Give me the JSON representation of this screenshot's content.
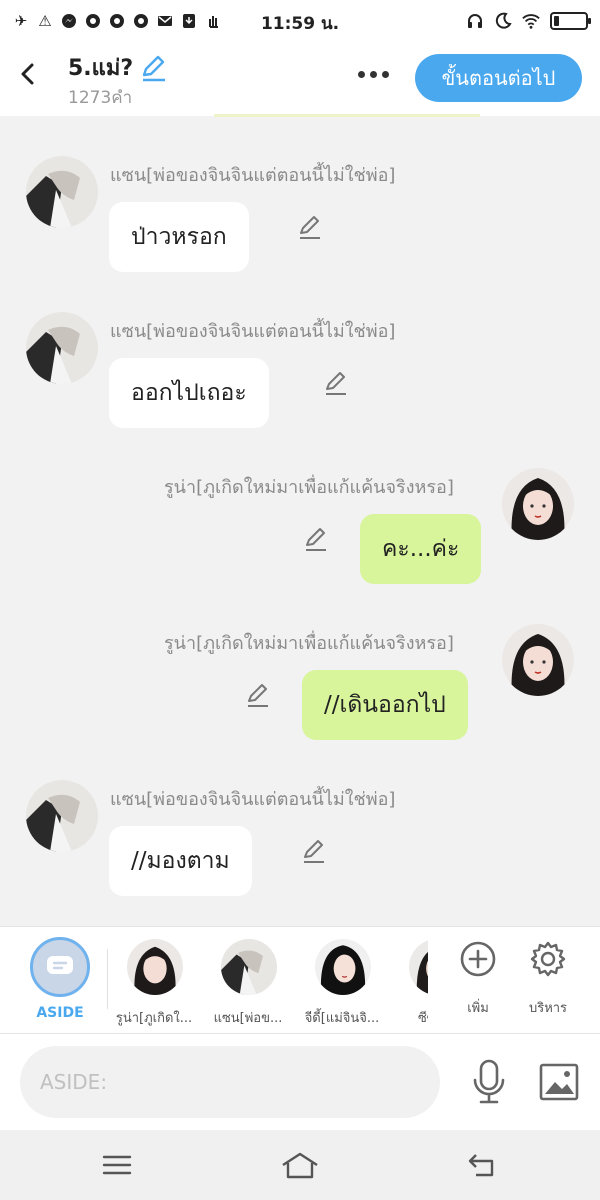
{
  "status_bar": {
    "time": "11:59 น.",
    "left_icons": [
      "airplane-icon",
      "warning-icon",
      "messenger-icon",
      "chrome-icon",
      "chrome-icon",
      "chrome-icon",
      "mail-icon",
      "download-icon",
      "hand-icon"
    ],
    "right_icons": [
      "headphones-icon",
      "moon-icon",
      "wifi-icon",
      "battery-icon"
    ],
    "battery_level": 0.15
  },
  "header": {
    "title": "5.แม่?",
    "word_count": "1273คำ",
    "next_label": "ขั้นตอนต่อไป"
  },
  "messages": [
    {
      "side": "left",
      "speaker": "แซน[พ่อของจินจินแต่ตอนนี้ไม่ใช่พ่อ]",
      "text": "ป่าวหรอก"
    },
    {
      "side": "left",
      "speaker": "แซน[พ่อของจินจินแต่ตอนนี้ไม่ใช่พ่อ]",
      "text": "ออกไปเถอะ"
    },
    {
      "side": "right",
      "speaker": "รูน่า[ภูเกิดใหม่มาเพื่อแก้แค้นจริงหรอ]",
      "text": "คะ...ค่ะ"
    },
    {
      "side": "right",
      "speaker": "รูน่า[ภูเกิดใหม่มาเพื่อแก้แค้นจริงหรอ]",
      "text": "//เดินออกไป"
    },
    {
      "side": "left",
      "speaker": "แซน[พ่อของจินจินแต่ตอนนี้ไม่ใช่พ่อ]",
      "text": "//มองตาม"
    }
  ],
  "character_bar": {
    "aside_label": "ASIDE",
    "characters": [
      {
        "name": "รูน่า[ภูเกิดใ..."
      },
      {
        "name": "แซน[พ่อข..."
      },
      {
        "name": "จีดี้[แม่จินจิ..."
      },
      {
        "name": "ซีซี้[เข้"
      }
    ],
    "add_label": "เพิ่ม",
    "manage_label": "บริหาร"
  },
  "input": {
    "placeholder": "ASIDE:"
  },
  "colors": {
    "accent": "#4aa8ef",
    "right_bubble": "#d8f59b",
    "left_bubble": "#ffffff",
    "chat_background": "#f2f2f2"
  }
}
